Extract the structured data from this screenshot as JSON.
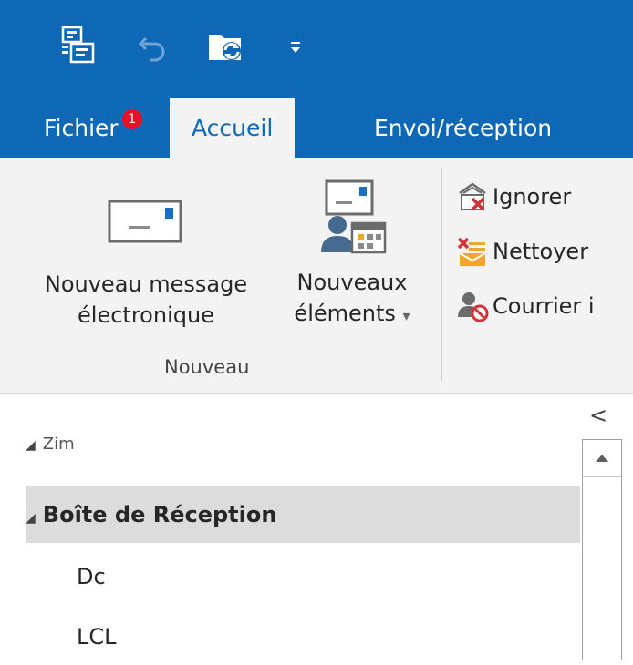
{
  "quick_access": {
    "icons": [
      "send-receive-all-icon",
      "undo-icon",
      "refresh-folder-icon",
      "customize-qat-icon"
    ],
    "customize_glyph": "="
  },
  "tabs": [
    {
      "label": "Fichier",
      "badge": "1"
    },
    {
      "label": "Accueil",
      "active": true
    },
    {
      "label": "Envoi/réception"
    }
  ],
  "ribbon": {
    "new_email": {
      "line1": "Nouveau message",
      "line2": "électronique"
    },
    "new_items": {
      "line1": "Nouveaux",
      "line2": "éléments",
      "dropdown": "▾"
    },
    "group_label": "Nouveau",
    "delete_group": [
      {
        "label": "Ignorer",
        "icon": "ignore-icon"
      },
      {
        "label": "Nettoyer ",
        "icon": "clean-up-icon"
      },
      {
        "label": "Courrier i",
        "icon": "junk-mail-icon"
      }
    ]
  },
  "folder_pane": {
    "collapse_glyph": "<",
    "folders": [
      {
        "label": "Zim",
        "expanded": true,
        "partial": true
      },
      {
        "label": "Boîte de Réception",
        "expanded": true,
        "selected": true
      },
      {
        "label": "Dc"
      },
      {
        "label": "LCL"
      }
    ]
  },
  "colors": {
    "title_bar": "#0f68b6",
    "ribbon_bg": "#f3f3f3",
    "selected_folder": "#dcdcdc",
    "badge": "#e81123"
  }
}
